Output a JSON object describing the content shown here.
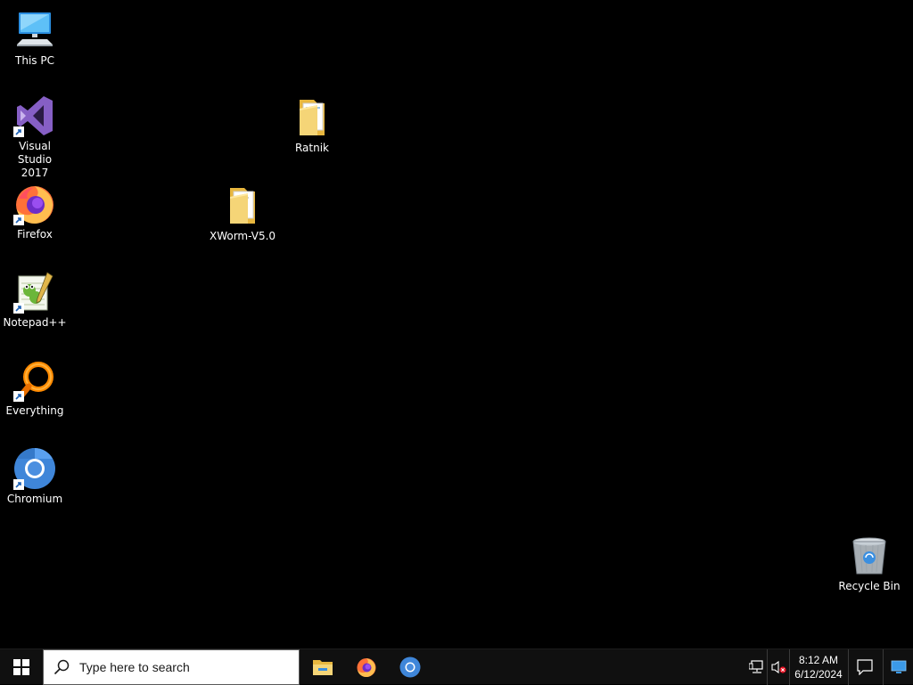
{
  "desktop": {
    "background_color": "#000000",
    "icons": [
      {
        "label": "This PC",
        "icon": "this-pc-icon",
        "shortcut": false
      },
      {
        "label": "Visual Studio\n2017",
        "icon": "visual-studio-icon",
        "shortcut": true
      },
      {
        "label": "Firefox",
        "icon": "firefox-icon",
        "shortcut": true
      },
      {
        "label": "Notepad++",
        "icon": "notepad-plus-plus-icon",
        "shortcut": true
      },
      {
        "label": "Everything",
        "icon": "everything-search-icon",
        "shortcut": true
      },
      {
        "label": "Chromium",
        "icon": "chromium-icon",
        "shortcut": true
      },
      {
        "label": "Ratnik",
        "icon": "folder-icon",
        "shortcut": false
      },
      {
        "label": "XWorm-V5.0",
        "icon": "folder-icon",
        "shortcut": false
      },
      {
        "label": "Recycle Bin",
        "icon": "recycle-bin-icon",
        "shortcut": false
      }
    ]
  },
  "taskbar": {
    "background_color": "#101010",
    "search_placeholder": "Type here to search",
    "pinned": [
      {
        "name": "File Explorer",
        "icon": "file-explorer-icon"
      },
      {
        "name": "Firefox",
        "icon": "firefox-icon"
      },
      {
        "name": "Chromium",
        "icon": "chromium-icon"
      }
    ],
    "tray": {
      "network_icon": "network-icon",
      "volume_icon": "volume-muted-icon",
      "time": "8:12 AM",
      "date": "6/12/2024",
      "notification_icon": "action-center-icon",
      "show_desktop_icon": "show-desktop-icon"
    }
  },
  "colors": {
    "accent": "#76b9ed",
    "folder": "#f5d577",
    "vs_purple": "#865fc5"
  }
}
